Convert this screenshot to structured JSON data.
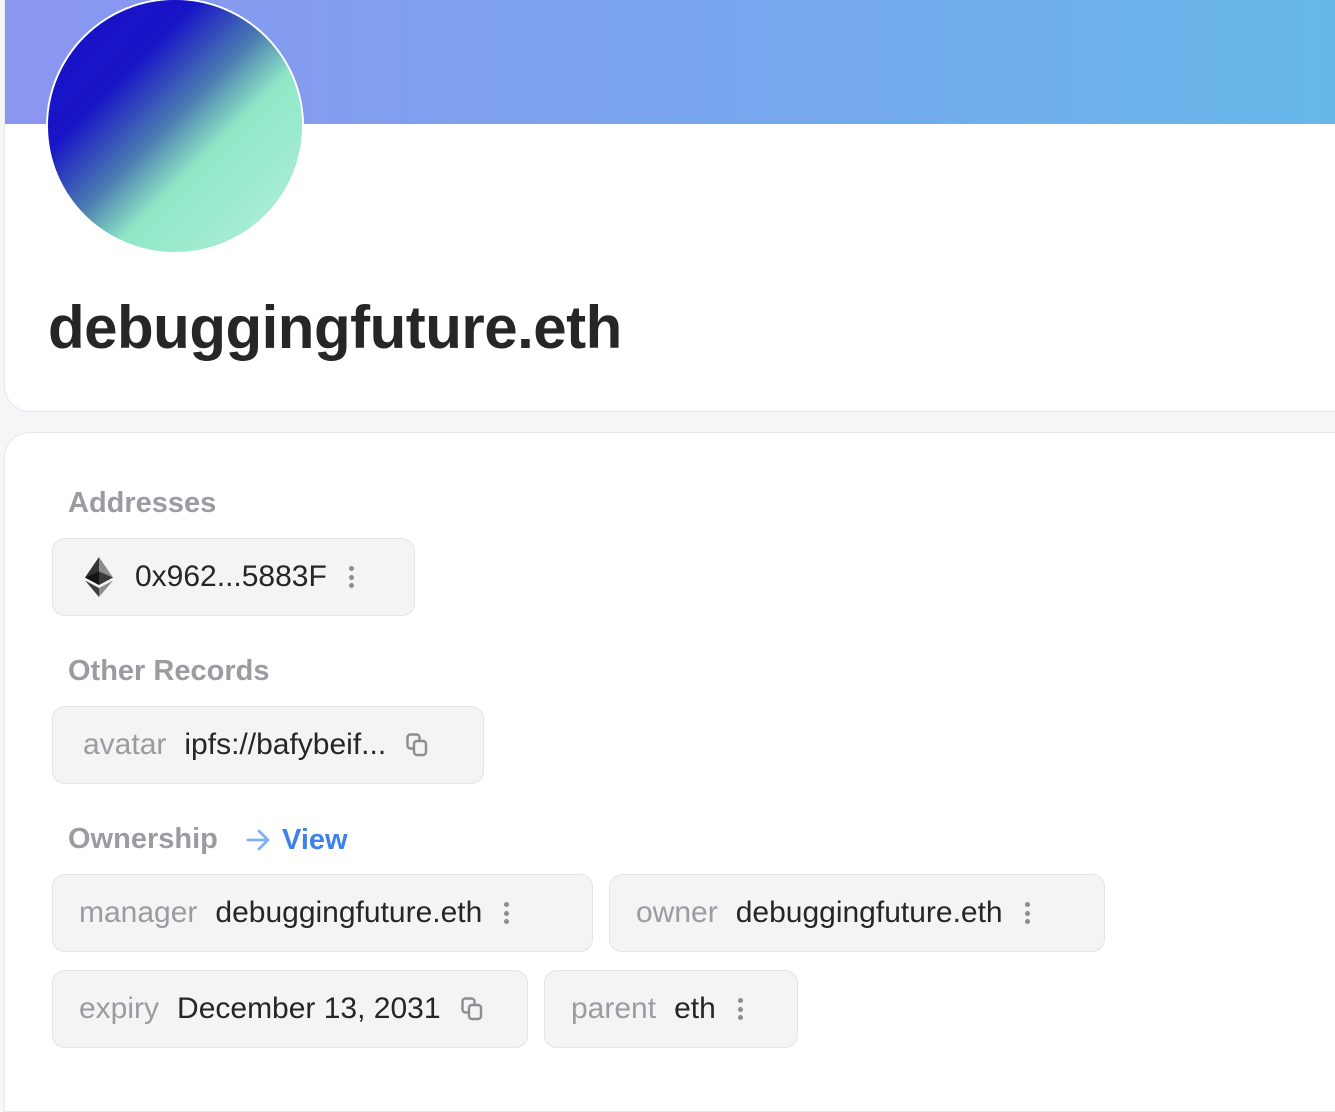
{
  "profile": {
    "name": "debuggingfuture.eth"
  },
  "sections": {
    "addresses": "Addresses",
    "other_records": "Other Records",
    "ownership": "Ownership",
    "ownership_link": "View"
  },
  "addresses": [
    {
      "coin_icon": "ethereum-icon",
      "value": "0x962...5883F",
      "action_icon": "kebab-menu-icon"
    }
  ],
  "other_records": [
    {
      "key": "avatar",
      "value": "ipfs://bafybeif...",
      "action_icon": "copy-icon"
    }
  ],
  "ownership": [
    {
      "key": "manager",
      "value": "debuggingfuture.eth",
      "action_icon": "kebab-menu-icon"
    },
    {
      "key": "owner",
      "value": "debuggingfuture.eth",
      "action_icon": "kebab-menu-icon"
    },
    {
      "key": "expiry",
      "value": "December 13, 2031",
      "action_icon": "copy-icon"
    },
    {
      "key": "parent",
      "value": "eth",
      "action_icon": "kebab-menu-icon"
    }
  ],
  "colors": {
    "banner_start": "#8b96f0",
    "banner_end": "#66b9e9",
    "avatar_start": "#1910c9",
    "avatar_end": "#8ee8c6",
    "link": "#3d82ea",
    "label": "#9b9ba1"
  }
}
